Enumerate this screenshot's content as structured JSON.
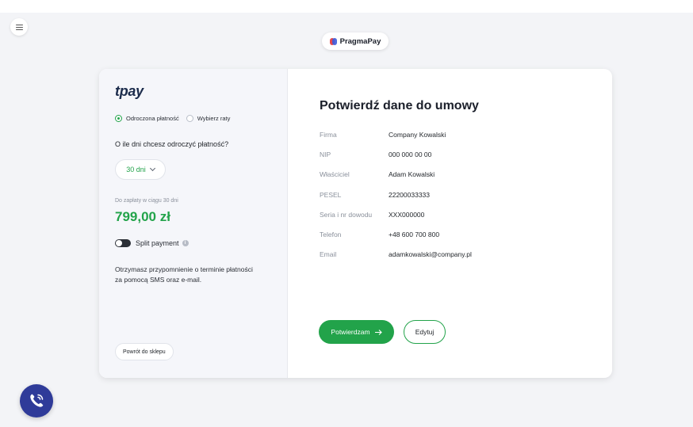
{
  "header": {
    "brand_name": "PragmaPay"
  },
  "left_panel": {
    "logo_text": "tpay",
    "payment_options": [
      {
        "label": "Odroczona płatność",
        "selected": true
      },
      {
        "label": "Wybierz raty",
        "selected": false
      }
    ],
    "question": "O ile dni chcesz odroczyć płatność?",
    "days_select": {
      "value": "30 dni"
    },
    "due_label": "Do zapłaty w ciągu 30 dni",
    "amount": "799,00 zł",
    "split_payment": {
      "label": "Split payment",
      "enabled": false
    },
    "reminder_text": "Otrzymasz przypomnienie o terminie płatności za pomocą SMS oraz e-mail.",
    "back_button": "Powrót do sklepu"
  },
  "contract": {
    "title": "Potwierdź dane do umowy",
    "fields": [
      {
        "label": "Firma",
        "value": "Company Kowalski"
      },
      {
        "label": "NIP",
        "value": "000 000 00 00"
      },
      {
        "label": "Właściciel",
        "value": "Adam Kowalski"
      },
      {
        "label": "PESEL",
        "value": "22200033333"
      },
      {
        "label": "Seria i nr dowodu",
        "value": "XXX000000"
      },
      {
        "label": "Telefon",
        "value": "+48 600 700 800"
      },
      {
        "label": "Email",
        "value": "adamkowalski@company.pl"
      }
    ],
    "confirm_button": "Potwierdzam",
    "edit_button": "Edytuj"
  },
  "colors": {
    "accent": "#22a34a",
    "fab": "#2f3b99",
    "background": "#f3f4f7"
  },
  "icons": {
    "menu": "hamburger-icon",
    "phone": "phone-icon",
    "arrow": "arrow-right-icon",
    "info": "info-icon"
  }
}
